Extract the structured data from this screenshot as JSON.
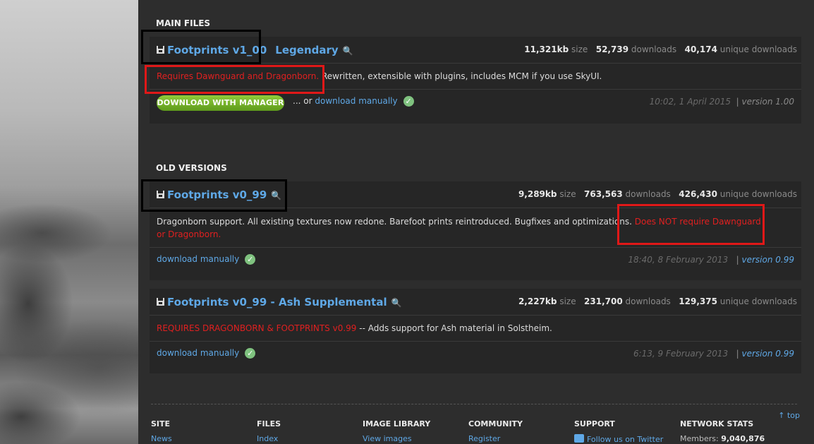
{
  "sections": {
    "main": "MAIN FILES",
    "old": "OLD VERSIONS"
  },
  "files": [
    {
      "name": "Footprints v1_00",
      "tag": "Legendary",
      "size": "11,321kb",
      "downloads": "52,739",
      "unique": "40,174",
      "desc_red": "Requires Dawnguard and Dragonborn.",
      "desc_rest": " Rewritten, extensible with plugins, includes MCM if you use SkyUI.",
      "download_button": "DOWNLOAD WITH MANAGER",
      "or_text": "... or",
      "download_manual": "download manually",
      "date": "10:02, 1 April 2015",
      "version": "| version 1.00"
    },
    {
      "name": "Footprints v0_99",
      "size": "9,289kb",
      "downloads": "763,563",
      "unique": "426,430",
      "desc_rest": "Dragonborn support. All existing textures now redone. Barefoot prints reintroduced. Bugfixes and optimizations.",
      "desc_red": "Does NOT require Dawnguard or Dragonborn.",
      "download_manual": "download manually",
      "date": "18:40, 8 February 2013",
      "version": "version 0.99"
    },
    {
      "name": "Footprints v0_99 - Ash Supplemental",
      "size": "2,227kb",
      "downloads": "231,700",
      "unique": "129,375",
      "desc_red": "REQUIRES DRAGONBORN & FOOTPRINTS v0.99",
      "desc_rest": " -- Adds support for Ash material in Solstheim.",
      "download_manual": "download manually",
      "date": "6:13, 9 February 2013",
      "version": "version 0.99"
    }
  ],
  "labels": {
    "size": "size",
    "downloads": "downloads",
    "unique": "unique downloads",
    "pipe": "|"
  },
  "footer": {
    "top": "top",
    "columns": [
      {
        "heading": "SITE",
        "item": "News"
      },
      {
        "heading": "FILES",
        "item": "Index"
      },
      {
        "heading": "IMAGE LIBRARY",
        "item": "View images"
      },
      {
        "heading": "COMMUNITY",
        "item": "Register"
      },
      {
        "heading": "SUPPORT",
        "item": "Follow us on Twitter"
      },
      {
        "heading": "NETWORK STATS",
        "item": "Members:",
        "value": "9,040,876"
      }
    ]
  }
}
